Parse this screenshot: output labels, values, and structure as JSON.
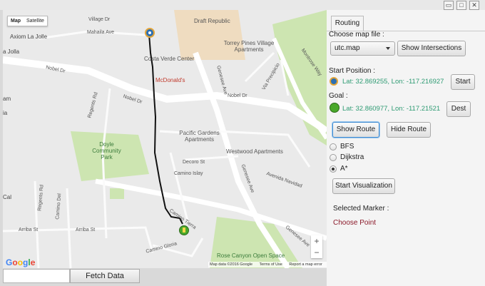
{
  "window": {
    "controls": [
      "▭",
      "□",
      "✕"
    ]
  },
  "map": {
    "type_control": {
      "map": "Map",
      "satellite": "Satellite"
    },
    "labels": {
      "axiom": "Axiom La Jolle",
      "jolla": "a Jolla",
      "village": "Village Dr",
      "mahaila": "Mahaila Ave",
      "costa": "Costa Verde Center",
      "draft": "Draft Republic",
      "torrey": "Torrey Pines Village Apartments",
      "nobel1": "Nobel Dr",
      "nobel2": "Nobel Dr",
      "nobel3": "Nobel Dr",
      "regents1": "Regents Rd",
      "regents2": "Regents Rd",
      "mcdonalds": "McDonald's",
      "pacific": "Pacific Gardens Apartments",
      "westwood": "Westwood Apartments",
      "doyle": "Doyle Community Park",
      "decoro": "Decoro St",
      "islay": "Camino Islay",
      "genesee1": "Genesee Ave",
      "genesee2": "Genesee Ave",
      "genesee3": "Genesee Ave",
      "arriba1": "Arriba St",
      "arriba2": "Arriba St",
      "tierra": "Camino Tierra",
      "gloria": "Camino Gloria",
      "rose": "Rose Canyon Open Space",
      "avenida": "Avenida Navidad",
      "precipicio": "Via Precipicio",
      "montrose": "Montrose Way",
      "camino_del": "Camino Del",
      "regents_left": "Regents",
      "am": "am",
      "ia": "ia",
      "cal": "Cal"
    },
    "google": "Google",
    "attribution": [
      "Map data ©2016 Google",
      "Terms of Use",
      "Report a map error"
    ],
    "zoom": {
      "plus": "+",
      "minus": "−"
    }
  },
  "bottom": {
    "fetch_label": "Fetch Data",
    "input_value": ""
  },
  "panel": {
    "tab": "Routing",
    "choose_map_label": "Choose map file :",
    "map_file": "utc.map",
    "show_intersections": "Show Intersections",
    "start_position_label": "Start Position :",
    "start_coords": "Lat: 32.869255, Lon: -117.216927",
    "start_button": "Start",
    "goal_label": "Goal :",
    "goal_coords": "Lat: 32.860977, Lon: -117.21521",
    "dest_button": "Dest",
    "show_route": "Show Route",
    "hide_route": "Hide Route",
    "algorithms": [
      "BFS",
      "Dijkstra",
      "A*"
    ],
    "selected_algorithm": "A*",
    "start_visualization": "Start Visualization",
    "selected_marker_label": "Selected Marker :",
    "choose_point": "Choose Point"
  },
  "colors": {
    "coords": "#2e9b73",
    "choose_point": "#8b1a2a",
    "park": "#c8e3a9",
    "highway": "#ffffff"
  }
}
